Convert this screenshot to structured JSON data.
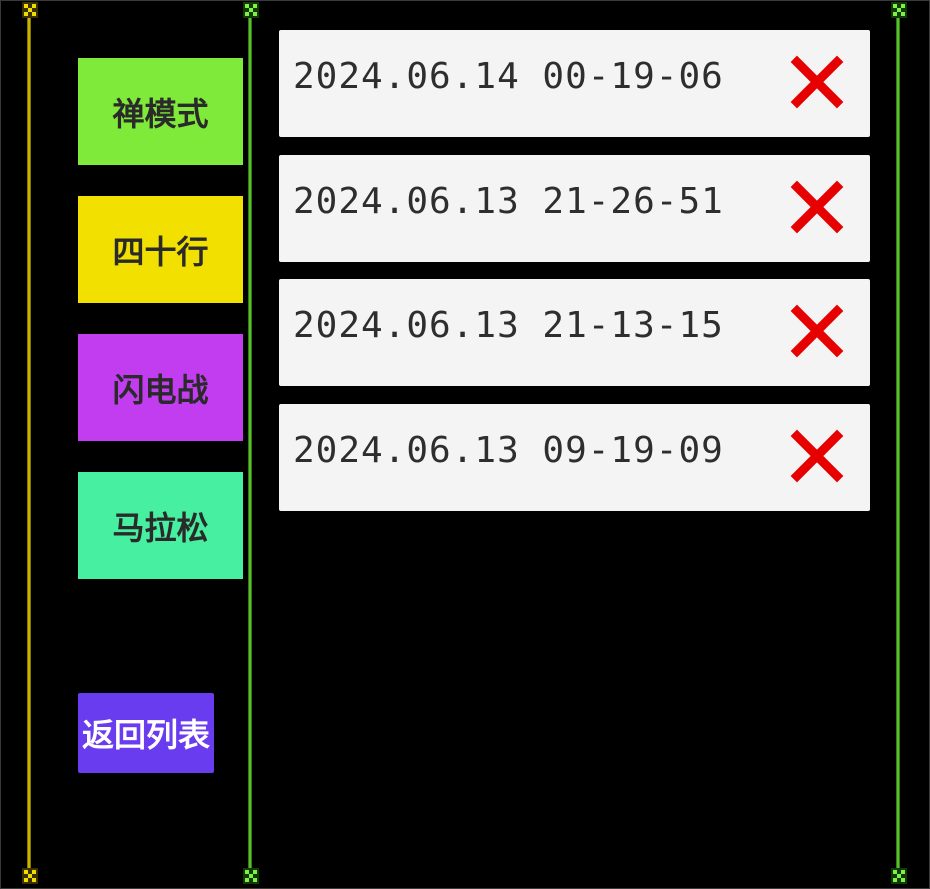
{
  "colors": {
    "rail_left": "#c8b400",
    "rail_green": "#4ec024",
    "mode_zen": "#7fea3a",
    "mode_forty": "#f2e000",
    "mode_blitz": "#c23cf0",
    "mode_marathon": "#46f0a0",
    "back_button": "#6a3cf0",
    "delete_x": "#e60000",
    "record_bg": "#f4f4f4"
  },
  "modes": [
    {
      "label": "禅模式",
      "color": "#7fea3a"
    },
    {
      "label": "四十行",
      "color": "#f2e000"
    },
    {
      "label": "闪电战",
      "color": "#c23cf0"
    },
    {
      "label": "马拉松",
      "color": "#46f0a0"
    }
  ],
  "back_button": {
    "label": "返回列表"
  },
  "records": [
    {
      "timestamp": "2024.06.14 00-19-06",
      "delete_icon": "close-icon"
    },
    {
      "timestamp": "2024.06.13 21-26-51",
      "delete_icon": "close-icon"
    },
    {
      "timestamp": "2024.06.13 21-13-15",
      "delete_icon": "close-icon"
    },
    {
      "timestamp": "2024.06.13 09-19-09",
      "delete_icon": "close-icon"
    }
  ]
}
